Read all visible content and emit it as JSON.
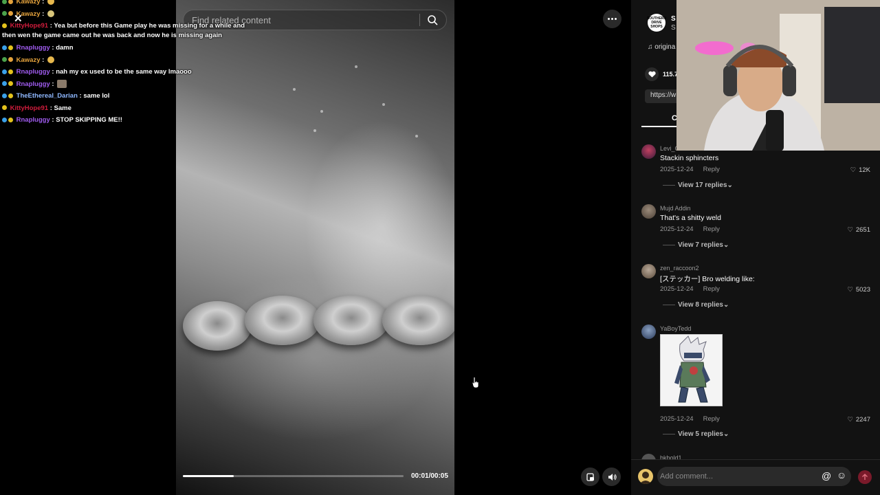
{
  "search": {
    "placeholder": "Find related content"
  },
  "player": {
    "timecode": "00:01/00:05",
    "progress": 0.23
  },
  "chat": {
    "lines": [
      {
        "user": "Kawazy",
        "sep": " :",
        "message": "",
        "color": "#e4a23c"
      },
      {
        "user": "Kawazy",
        "sep": " :",
        "message": "",
        "color": "#e4a23c"
      },
      {
        "user": "KittyHope91",
        "sep": " :",
        "message": "Yea but before this Game play he was missing for a while and then wen the game came out he was back and now he is missing again",
        "color": "#d01c3c"
      },
      {
        "user": "Rnapluggy",
        "sep": " :",
        "message": "damn",
        "color": "#a05cf0"
      },
      {
        "user": "Kawazy",
        "sep": " :",
        "message": "",
        "color": "#e4a23c"
      },
      {
        "user": "Rnapluggy",
        "sep": " :",
        "message": "nah my ex used to be the same way lmaooo",
        "color": "#a05cf0"
      },
      {
        "user": "Rnapluggy",
        "sep": " :",
        "message": "",
        "color": "#a05cf0"
      },
      {
        "user": "TheEthereal_Darian",
        "sep": " :",
        "message": "same lol",
        "color": "#8fb8ff"
      },
      {
        "user": "KittyHope91",
        "sep": " :",
        "message": "Same",
        "color": "#d01c3c"
      },
      {
        "user": "Rnapluggy",
        "sep": " :",
        "message": "STOP SKIPPING ME!!",
        "color": "#a05cf0"
      }
    ]
  },
  "panel": {
    "author_avatar_text": "SOUTHERN DRIVE SHOPS",
    "author_name": "S",
    "author_sub": "S",
    "music": "origina",
    "likes": "115.7",
    "link": "https://w",
    "tab_letter": "C"
  },
  "comments": [
    {
      "user": "Levi_G",
      "text": "Stackin sphincters",
      "date": "2025-12-24",
      "reply": "Reply",
      "likes": "12K",
      "replies": "View 17 replies"
    },
    {
      "user": "Mujd Addin",
      "text": "That's a shitty weld",
      "date": "2025-12-24",
      "reply": "Reply",
      "likes": "2651",
      "replies": "View 7 replies"
    },
    {
      "user": "zen_raccoon2",
      "text": "[ステッカー] Bro welding like:",
      "date": "2025-12-24",
      "reply": "Reply",
      "likes": "5023",
      "replies": "View 8 replies"
    },
    {
      "user": "YaBoyTedd",
      "text": "",
      "date": "2025-12-24",
      "reply": "Reply",
      "likes": "2247",
      "replies": "View 5 replies"
    },
    {
      "user": "bkbold1",
      "text": ""
    }
  ],
  "comment_bar": {
    "placeholder": "Add comment..."
  },
  "colors": {
    "panel_bg": "#121212",
    "accent": "#fe2c55",
    "muted": "#9a9a9a"
  },
  "icons": [
    "search-icon",
    "more-icon",
    "close-icon",
    "music-note-icon",
    "heart-icon",
    "chevron-down-icon",
    "at-icon",
    "emoji-icon",
    "arrow-up-icon",
    "volume-icon",
    "pip-icon",
    "cursor-icon"
  ]
}
